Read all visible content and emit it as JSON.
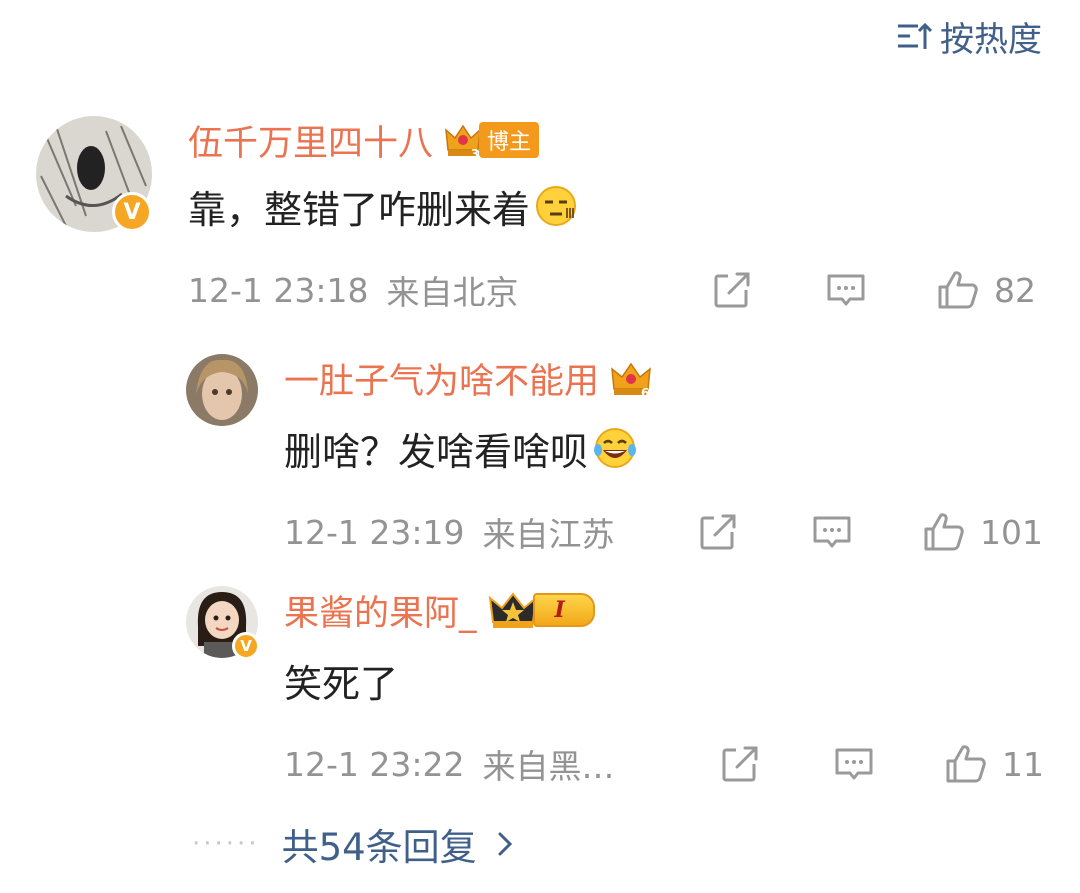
{
  "sort": {
    "label": "按热度",
    "icon": "sort-icon"
  },
  "comments": [
    {
      "username": "伍千万里四十八",
      "badge": {
        "level": "3",
        "label": "博主",
        "icon": "crown-icon"
      },
      "verified": true,
      "text": "靠，整错了咋删来着",
      "emoji": "speechless-emoji",
      "time": "12-1 23:18",
      "location": "来自北京",
      "likes": "82"
    },
    {
      "username": "一肚子气为啥不能用",
      "badge": {
        "level": "6",
        "icon": "crown-icon"
      },
      "verified": false,
      "text": "删啥？发啥看啥呗",
      "emoji": "laughing-emoji",
      "time": "12-1 23:19",
      "location": "来自江苏",
      "likes": "101"
    },
    {
      "username": "果酱的果阿_",
      "badge": {
        "label": "I",
        "icon": "crown-icon"
      },
      "verified": true,
      "text": "笑死了",
      "time": "12-1 23:22",
      "location": "来自黑…",
      "likes": "11"
    }
  ],
  "more_replies": {
    "label": "共54条回复",
    "icon": "chevron-right-icon"
  },
  "colors": {
    "name": "#eb7350",
    "link": "#40608a",
    "meta": "#939393",
    "text": "#222222",
    "badge": "#f5a623"
  }
}
